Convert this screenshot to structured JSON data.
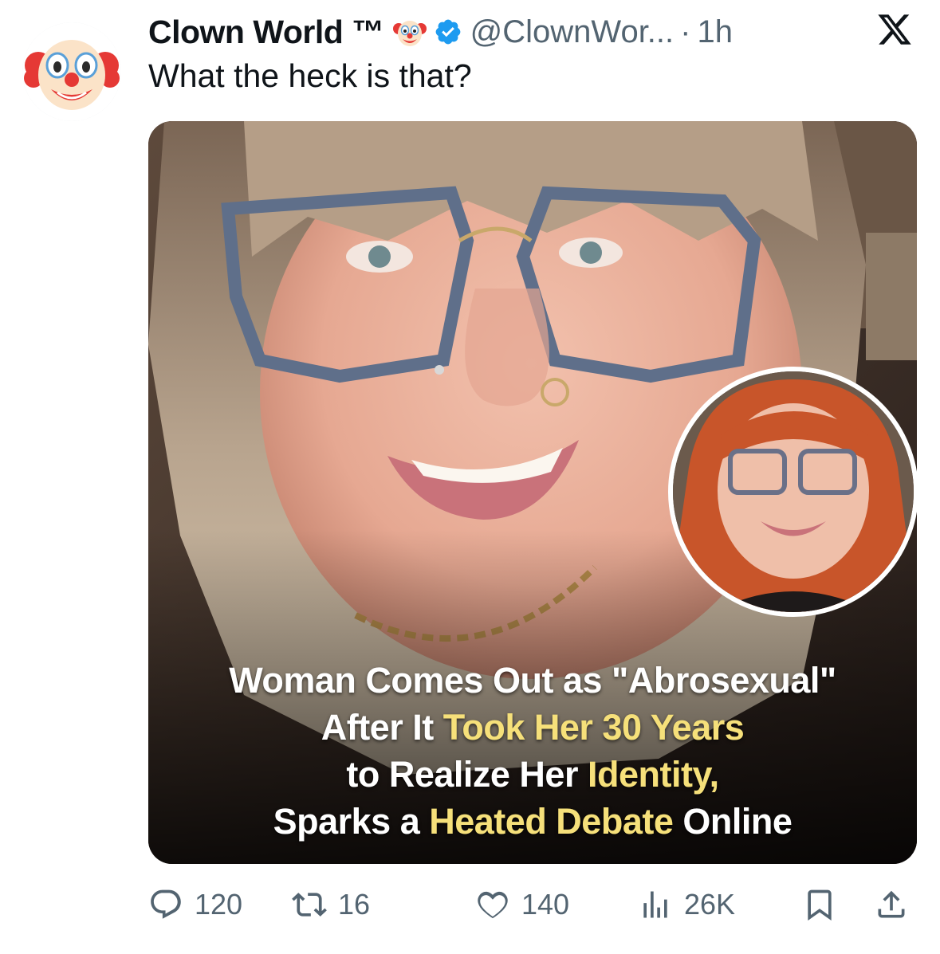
{
  "author": {
    "name": "Clown World ™",
    "handle": "@ClownWor...",
    "separator": "·",
    "time": "1h",
    "avatar_icon": "clown-face-icon",
    "verified_icon": "verified-badge-icon",
    "verified_color": "#1d9bf0"
  },
  "platform_icon": "x-logo-icon",
  "tweet": {
    "text": "What the heck is that?"
  },
  "media": {
    "headline_lines": [
      [
        {
          "text": "Woman Comes Out as \"Abrosexual\"",
          "highlight": false
        }
      ],
      [
        {
          "text": "After It ",
          "highlight": false
        },
        {
          "text": "Took Her 30 Years",
          "highlight": true
        }
      ],
      [
        {
          "text": "to Realize Her ",
          "highlight": false
        },
        {
          "text": "Identity,",
          "highlight": true
        }
      ],
      [
        {
          "text": "Sparks a ",
          "highlight": false
        },
        {
          "text": "Heated Debate",
          "highlight": true
        },
        {
          "text": " Online",
          "highlight": false
        }
      ]
    ],
    "highlight_color": "#f6e07a"
  },
  "actions": {
    "replies": "120",
    "retweets": "16",
    "likes": "140",
    "views": "26K"
  }
}
